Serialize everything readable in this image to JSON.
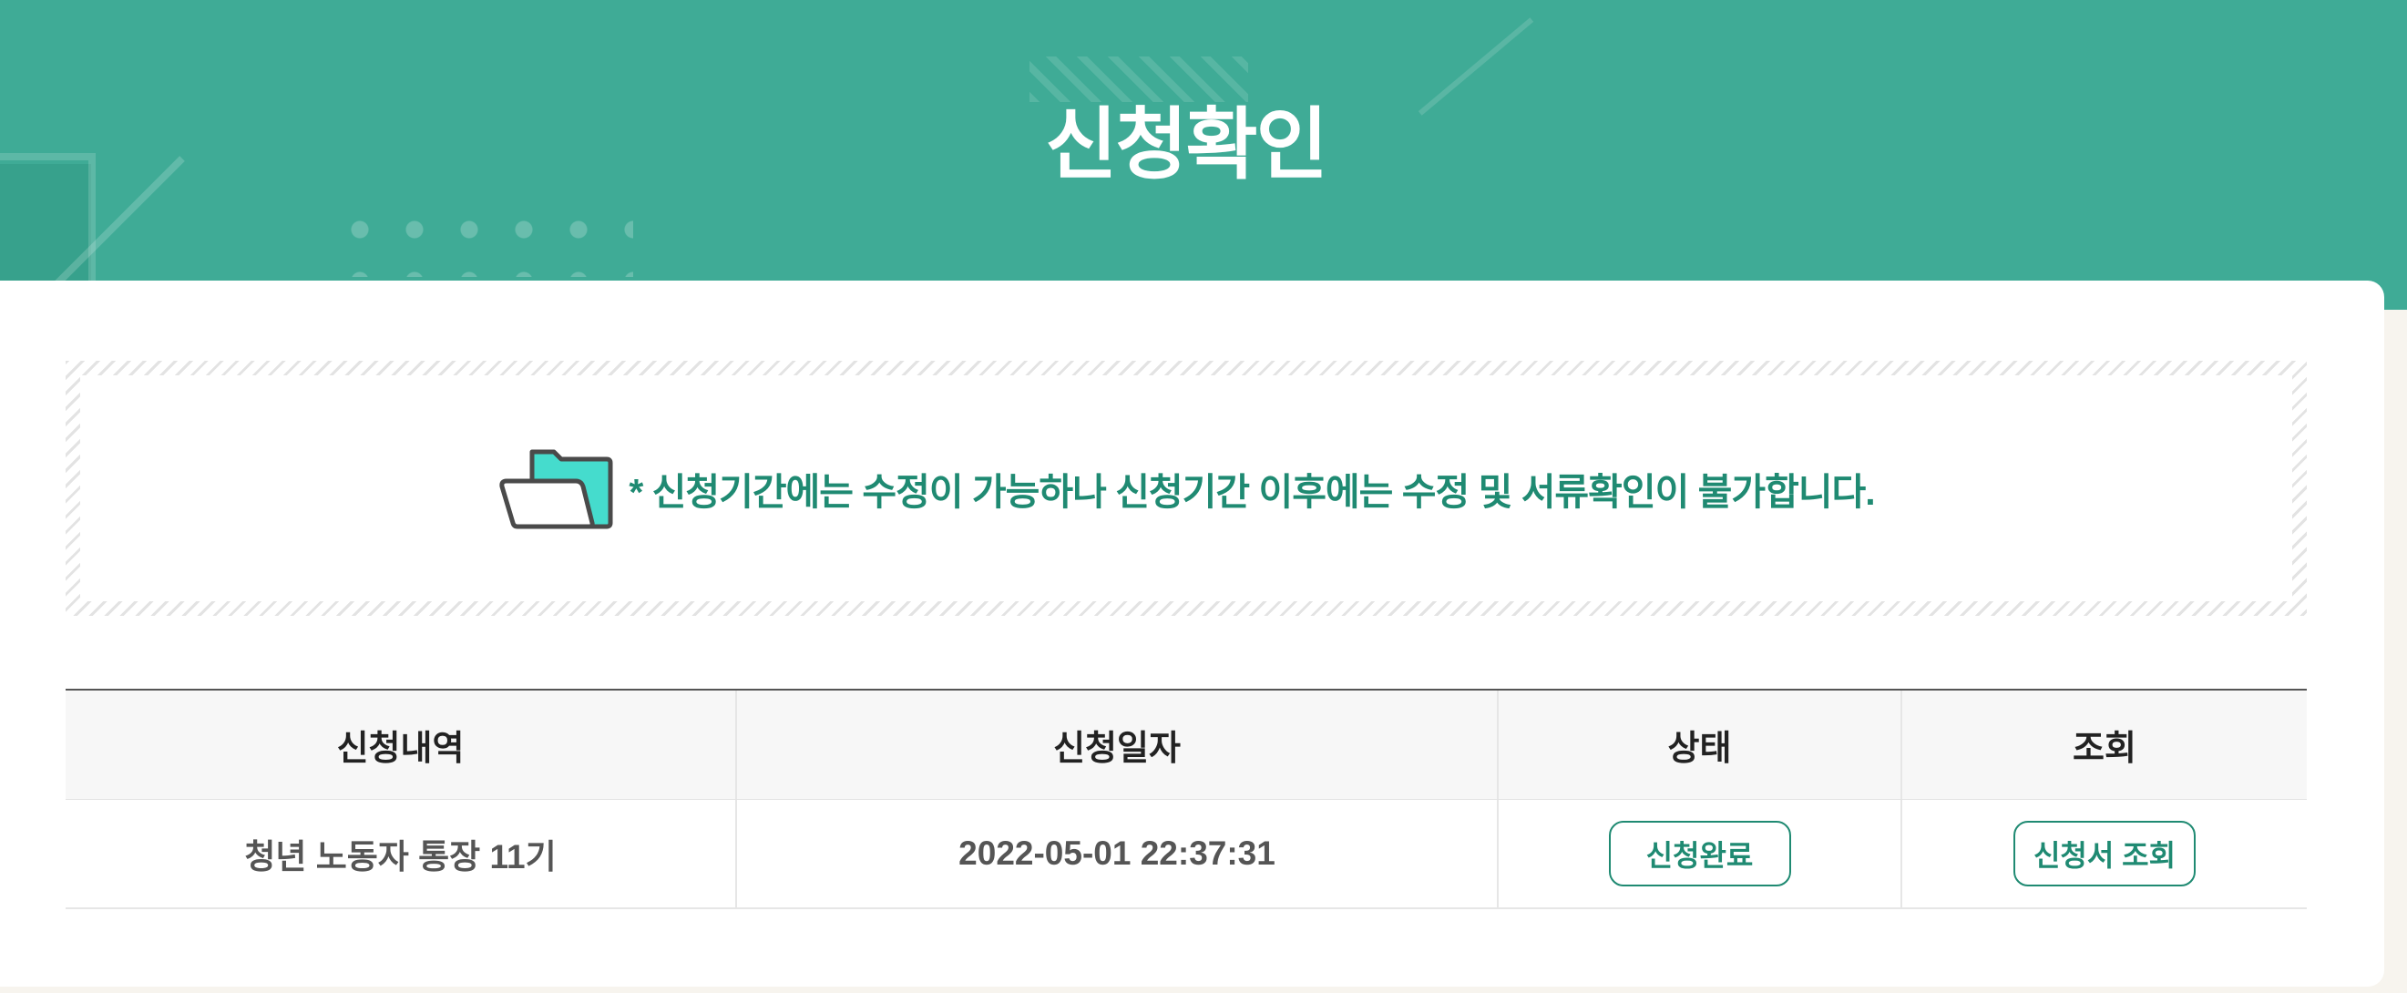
{
  "page": {
    "title": "신청확인"
  },
  "notice": {
    "icon": "folder-open-icon",
    "text": "* 신청기간에는 수정이 가능하나 신청기간 이후에는 수정 및 서류확인이 불가합니다."
  },
  "table": {
    "headers": [
      "신청내역",
      "신청일자",
      "상태",
      "조회"
    ],
    "rows": [
      {
        "name": "청년 노동자 통장 11기",
        "date": "2022-05-01 22:37:31",
        "status_button": "신청완료",
        "view_button": "신청서 조회"
      }
    ]
  },
  "colors": {
    "brand": "#3fab96",
    "accent_text": "#1f8a72"
  }
}
